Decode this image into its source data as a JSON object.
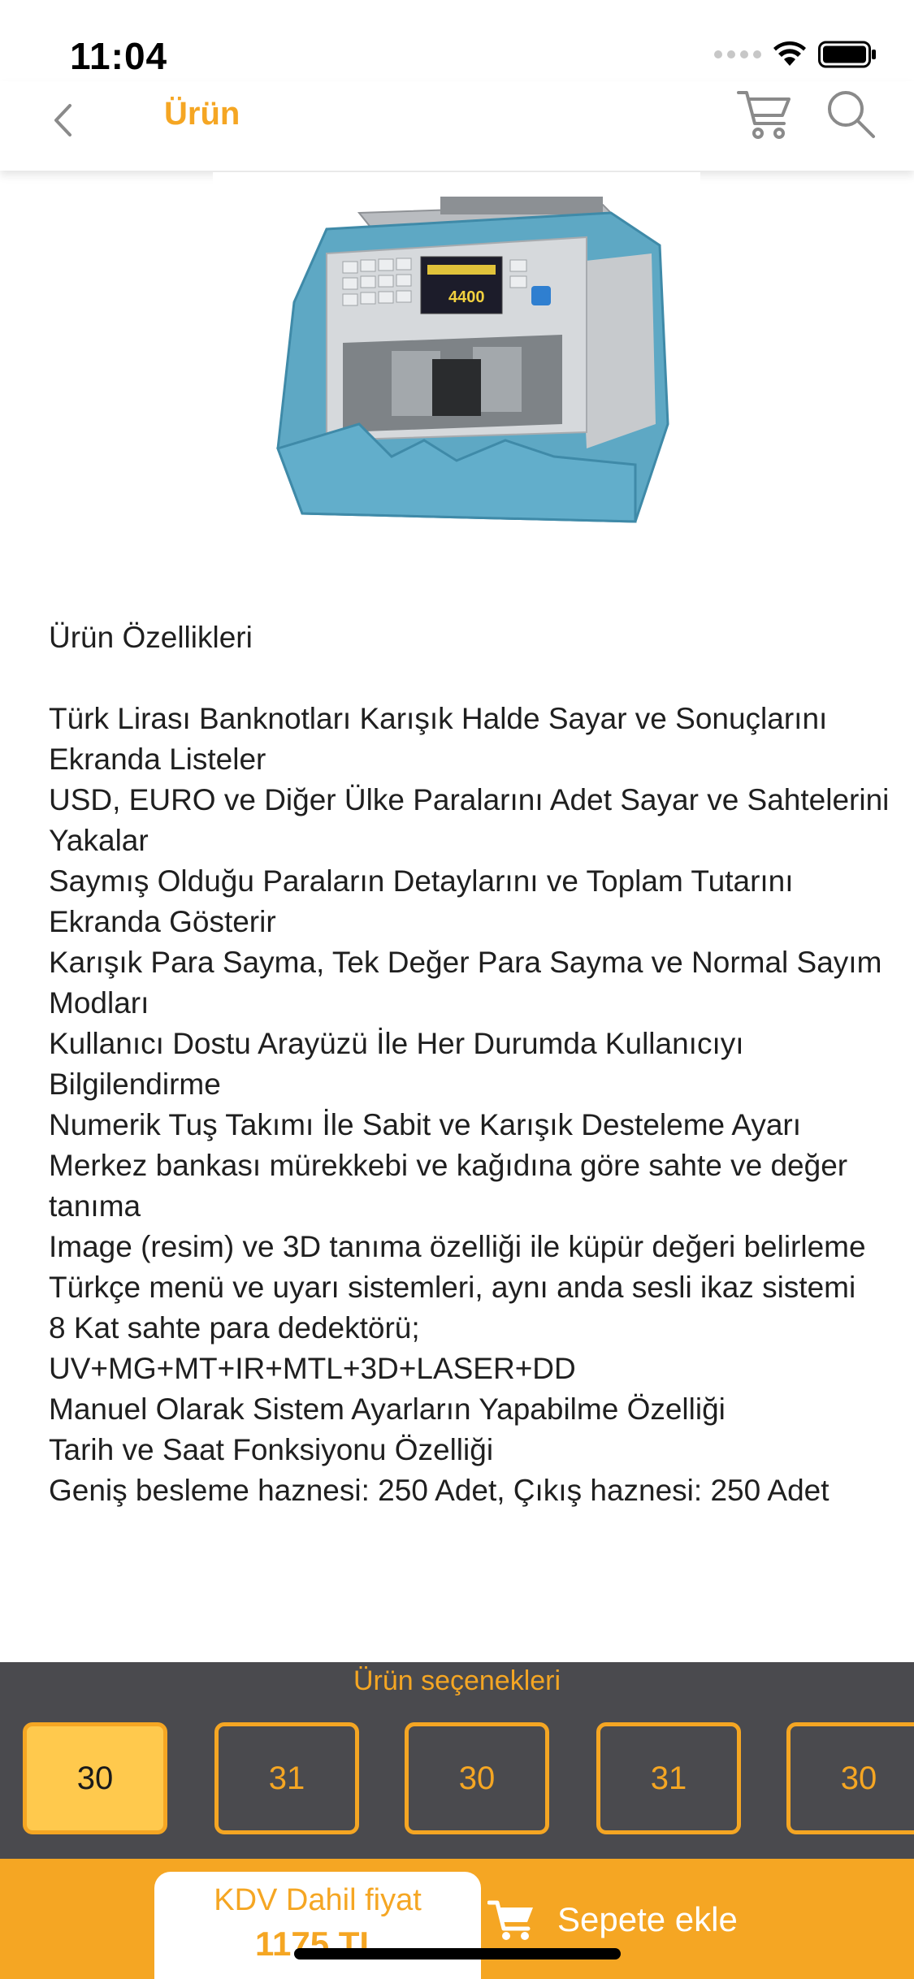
{
  "status": {
    "time": "11:04"
  },
  "nav": {
    "title": "Ürün",
    "icons": [
      "chevron-left-icon",
      "cart-icon",
      "search-icon"
    ]
  },
  "product": {
    "image_alt": "money-counter-machine",
    "description_title": "Ürün Özellikleri",
    "features": [
      "Türk Lirası Banknotları Karışık Halde Sayar ve Sonuçlarını Ekranda Listeler",
      "USD, EURO ve Diğer Ülke Paralarını Adet Sayar ve Sahtelerini Yakalar",
      "Saymış Olduğu Paraların Detaylarını ve Toplam Tutarını Ekranda Gösterir",
      "Karışık Para Sayma, Tek Değer Para Sayma ve Normal Sayım Modları",
      "Kullanıcı Dostu Arayüzü İle Her Durumda Kullanıcıyı Bilgilendirme",
      "Numerik Tuş Takımı İle Sabit ve Karışık Desteleme Ayarı",
      "Merkez bankası mürekkebi ve kağıdına göre sahte ve değer tanıma",
      "Image (resim) ve 3D tanıma özelliği ile küpür değeri belirleme",
      "Türkçe menü ve uyarı sistemleri, aynı anda sesli ikaz sistemi",
      "8 Kat sahte para dedektörü; UV+MG+MT+IR+MTL+3D+LASER+DD",
      "Manuel Olarak Sistem Ayarların Yapabilme Özelliği",
      "Tarih ve Saat Fonksiyonu Özelliği",
      "Geniş besleme haznesi: 250 Adet, Çıkış haznesi: 250 Adet"
    ]
  },
  "options": {
    "title": "Ürün seçenekleri",
    "items": [
      "30",
      "31",
      "30",
      "31",
      "30"
    ],
    "selected_index": 0
  },
  "bottom": {
    "price_label": "KDV Dahil fiyat",
    "price_value": "1175 TL",
    "add_to_cart_label": "Sepete ekle"
  },
  "colors": {
    "accent": "#f5a623",
    "options_bg": "#4a4a4e",
    "selected_option_bg": "#ffc94d"
  }
}
